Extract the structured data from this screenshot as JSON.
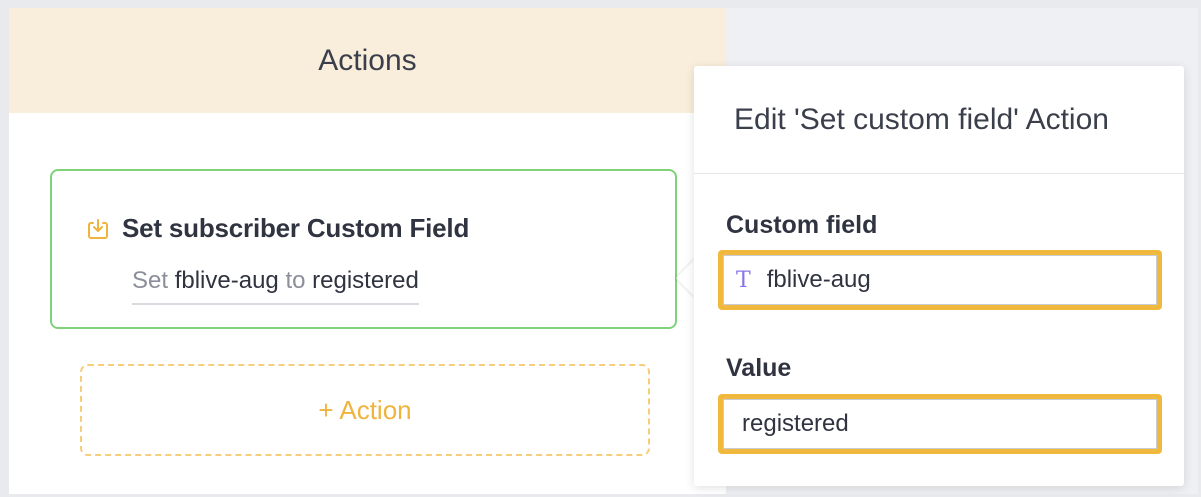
{
  "actions_panel": {
    "header": "Actions",
    "action_card": {
      "title": "Set subscriber Custom Field",
      "summary_prefix": "Set",
      "field_name": "fblive-aug",
      "summary_mid": "to",
      "value": "registered",
      "icon": "download-box-icon"
    },
    "add_action_label": "+ Action"
  },
  "popover": {
    "title": "Edit 'Set custom field' Action",
    "custom_field_label": "Custom field",
    "custom_field_value": "fblive-aug",
    "custom_field_type_icon": "text-type-icon",
    "value_label": "Value",
    "value_value": "registered"
  },
  "colors": {
    "header_bg": "#f9eedb",
    "card_border": "#7fd27a",
    "accent": "#f0b33d",
    "type_icon": "#8a74e8"
  }
}
